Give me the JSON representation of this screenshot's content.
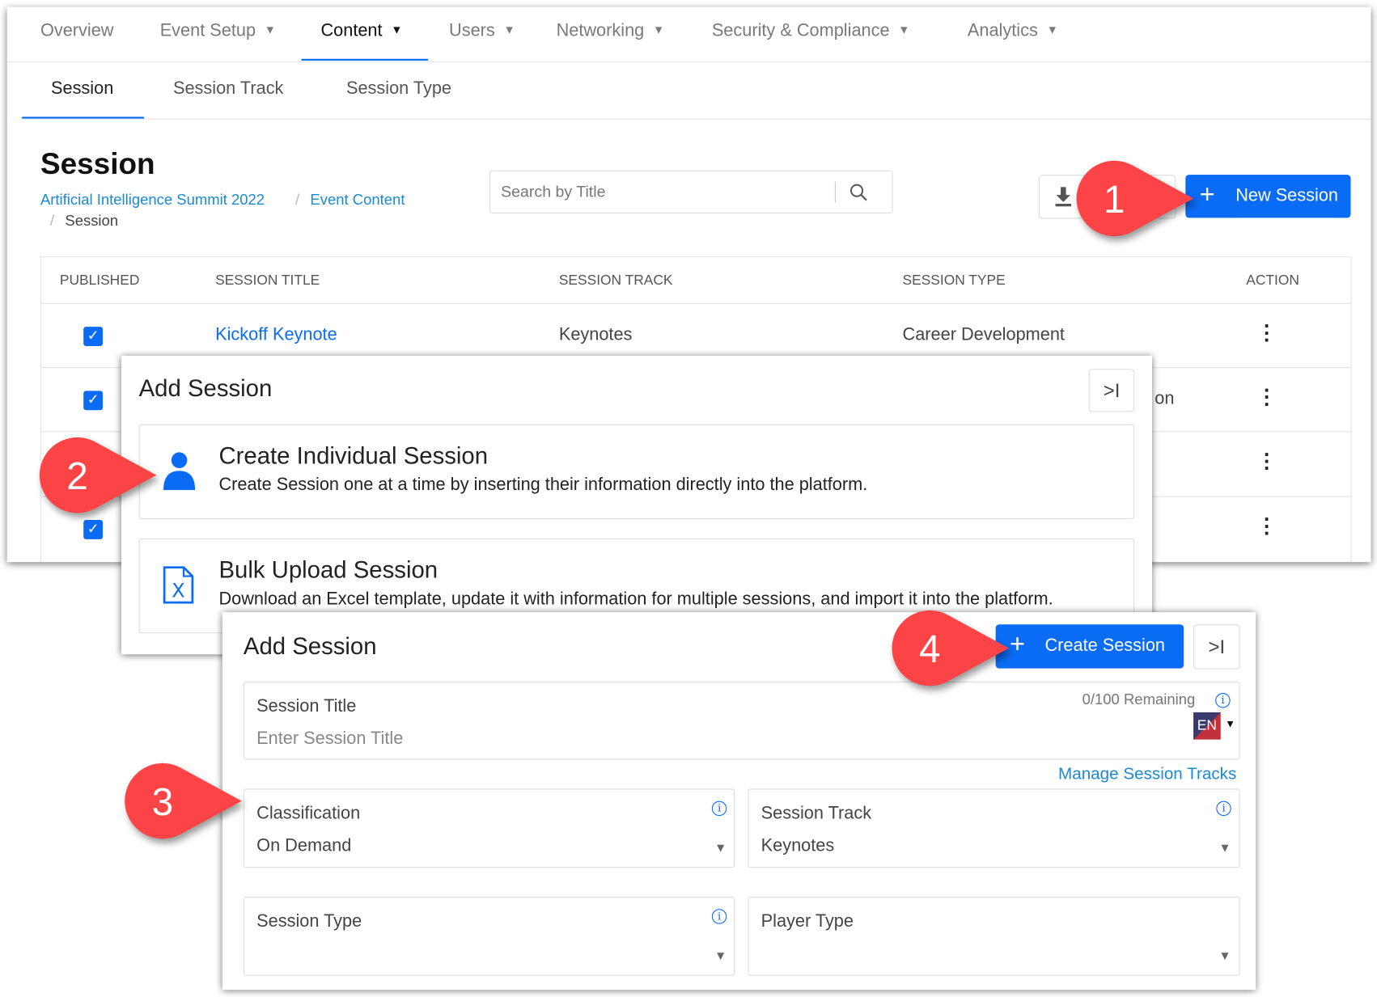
{
  "colors": {
    "accent": "#0a6cf5",
    "callout": "#fc4447",
    "link": "#1a8ad4"
  },
  "nav": {
    "items": [
      {
        "label": "Overview",
        "dropdown": false
      },
      {
        "label": "Event Setup",
        "dropdown": true
      },
      {
        "label": "Content",
        "dropdown": true,
        "active": true
      },
      {
        "label": "Users",
        "dropdown": true
      },
      {
        "label": "Networking",
        "dropdown": true
      },
      {
        "label": "Security & Compliance",
        "dropdown": true
      },
      {
        "label": "Analytics",
        "dropdown": true
      }
    ]
  },
  "subtabs": [
    "Session",
    "Session Track",
    "Session Type"
  ],
  "page": {
    "title": "Session",
    "breadcrumb": [
      "Artificial Intelligence Summit 2022",
      "Event Content",
      "Session"
    ],
    "search_placeholder": "Search by Title",
    "new_button": "New Session"
  },
  "table": {
    "headers": [
      "PUBLISHED",
      "SESSION TITLE",
      "SESSION TRACK",
      "SESSION TYPE",
      "ACTION"
    ],
    "rows": [
      {
        "published": true,
        "title": "Kickoff Keynote",
        "track": "Keynotes",
        "type": "Career Development"
      },
      {
        "published": true,
        "title": "",
        "track": "",
        "type": "on"
      },
      {
        "published": true,
        "title": "",
        "track": "",
        "type": ""
      },
      {
        "published": true,
        "title": "",
        "track": "",
        "type": ""
      }
    ]
  },
  "add_menu": {
    "title": "Add Session",
    "collapse": ">I",
    "options": [
      {
        "title": "Create Individual Session",
        "description": "Create Session one at a time by inserting their information directly into the platform.",
        "icon": "person-icon"
      },
      {
        "title": "Bulk Upload Session",
        "description": "Download an Excel template, update it with information for multiple sessions, and import it into the platform.",
        "icon": "excel-file-icon"
      }
    ]
  },
  "form": {
    "title": "Add Session",
    "create_button": "Create Session",
    "collapse": ">I",
    "session_title": {
      "label": "Session Title",
      "placeholder": "Enter Session Title",
      "remaining": "0/100 Remaining",
      "language": "EN"
    },
    "manage_link": "Manage Session Tracks",
    "classification": {
      "label": "Classification",
      "value": "On Demand"
    },
    "session_track": {
      "label": "Session Track",
      "value": "Keynotes"
    },
    "session_type": {
      "label": "Session Type",
      "value": ""
    },
    "player_type": {
      "label": "Player Type",
      "value": ""
    }
  },
  "callouts": [
    "1",
    "2",
    "3",
    "4"
  ]
}
